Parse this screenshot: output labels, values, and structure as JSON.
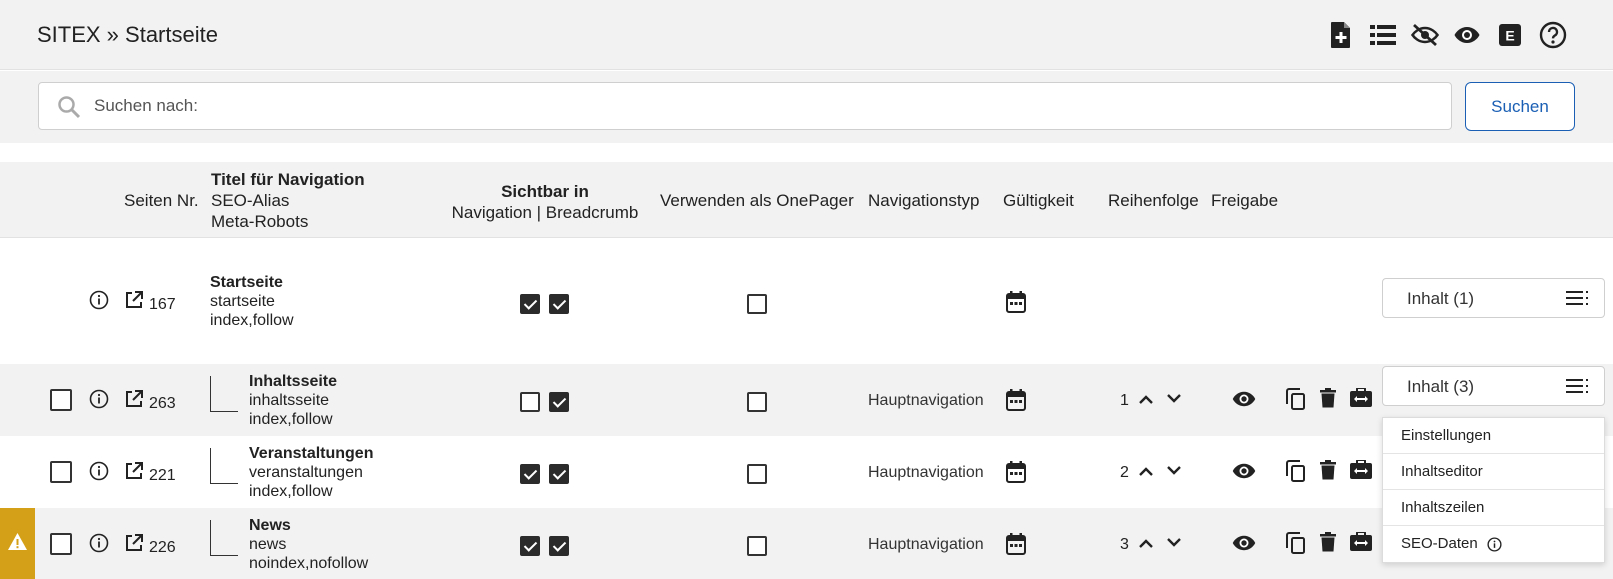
{
  "header": {
    "breadcrumb": "SITEX » Startseite",
    "icons": [
      "add-page-icon",
      "list-icon",
      "eye-off-icon",
      "eye-icon",
      "e-icon",
      "help-icon"
    ]
  },
  "search": {
    "placeholder": "Suchen nach:",
    "value": "",
    "button_label": "Suchen"
  },
  "table": {
    "headers": {
      "page_nr": "Seiten Nr.",
      "title_line1": "Titel für Navigation",
      "title_line2": "SEO-Alias",
      "title_line3": "Meta-Robots",
      "visible_line1": "Sichtbar in",
      "visible_line2": "Navigation | Breadcrumb",
      "onepager": "Verwenden als OnePager",
      "navtype": "Navigationstyp",
      "validity": "Gültigkeit",
      "order": "Reihenfolge",
      "release": "Freigabe"
    },
    "rows": [
      {
        "id": "167",
        "title": "Startseite",
        "alias": "startseite",
        "robots": "index,follow",
        "nav_visible": true,
        "breadcrumb_visible": true,
        "onepager": false,
        "navtype": "",
        "order": "",
        "inhalt": "Inhalt (1)"
      },
      {
        "id": "263",
        "title": "Inhaltsseite",
        "alias": "inhaltsseite",
        "robots": "index,follow",
        "nav_visible": false,
        "breadcrumb_visible": true,
        "onepager": false,
        "navtype": "Hauptnavigation",
        "order": "1",
        "inhalt": "Inhalt (3)"
      },
      {
        "id": "221",
        "title": "Veranstaltungen",
        "alias": "veranstaltungen",
        "robots": "index,follow",
        "nav_visible": true,
        "breadcrumb_visible": true,
        "onepager": false,
        "navtype": "Hauptnavigation",
        "order": "2",
        "inhalt": ""
      },
      {
        "id": "226",
        "title": "News",
        "alias": "news",
        "robots": "noindex,nofollow",
        "nav_visible": true,
        "breadcrumb_visible": true,
        "onepager": false,
        "navtype": "Hauptnavigation",
        "order": "3",
        "inhalt": "",
        "warning": true
      }
    ]
  },
  "dropdown": {
    "items": [
      "Einstellungen",
      "Inhaltseditor",
      "Inhaltszeilen",
      "SEO-Daten"
    ]
  },
  "colors": {
    "accent": "#1a5fb4",
    "warning": "#d4a017",
    "header_bg": "#f2f2f2"
  }
}
